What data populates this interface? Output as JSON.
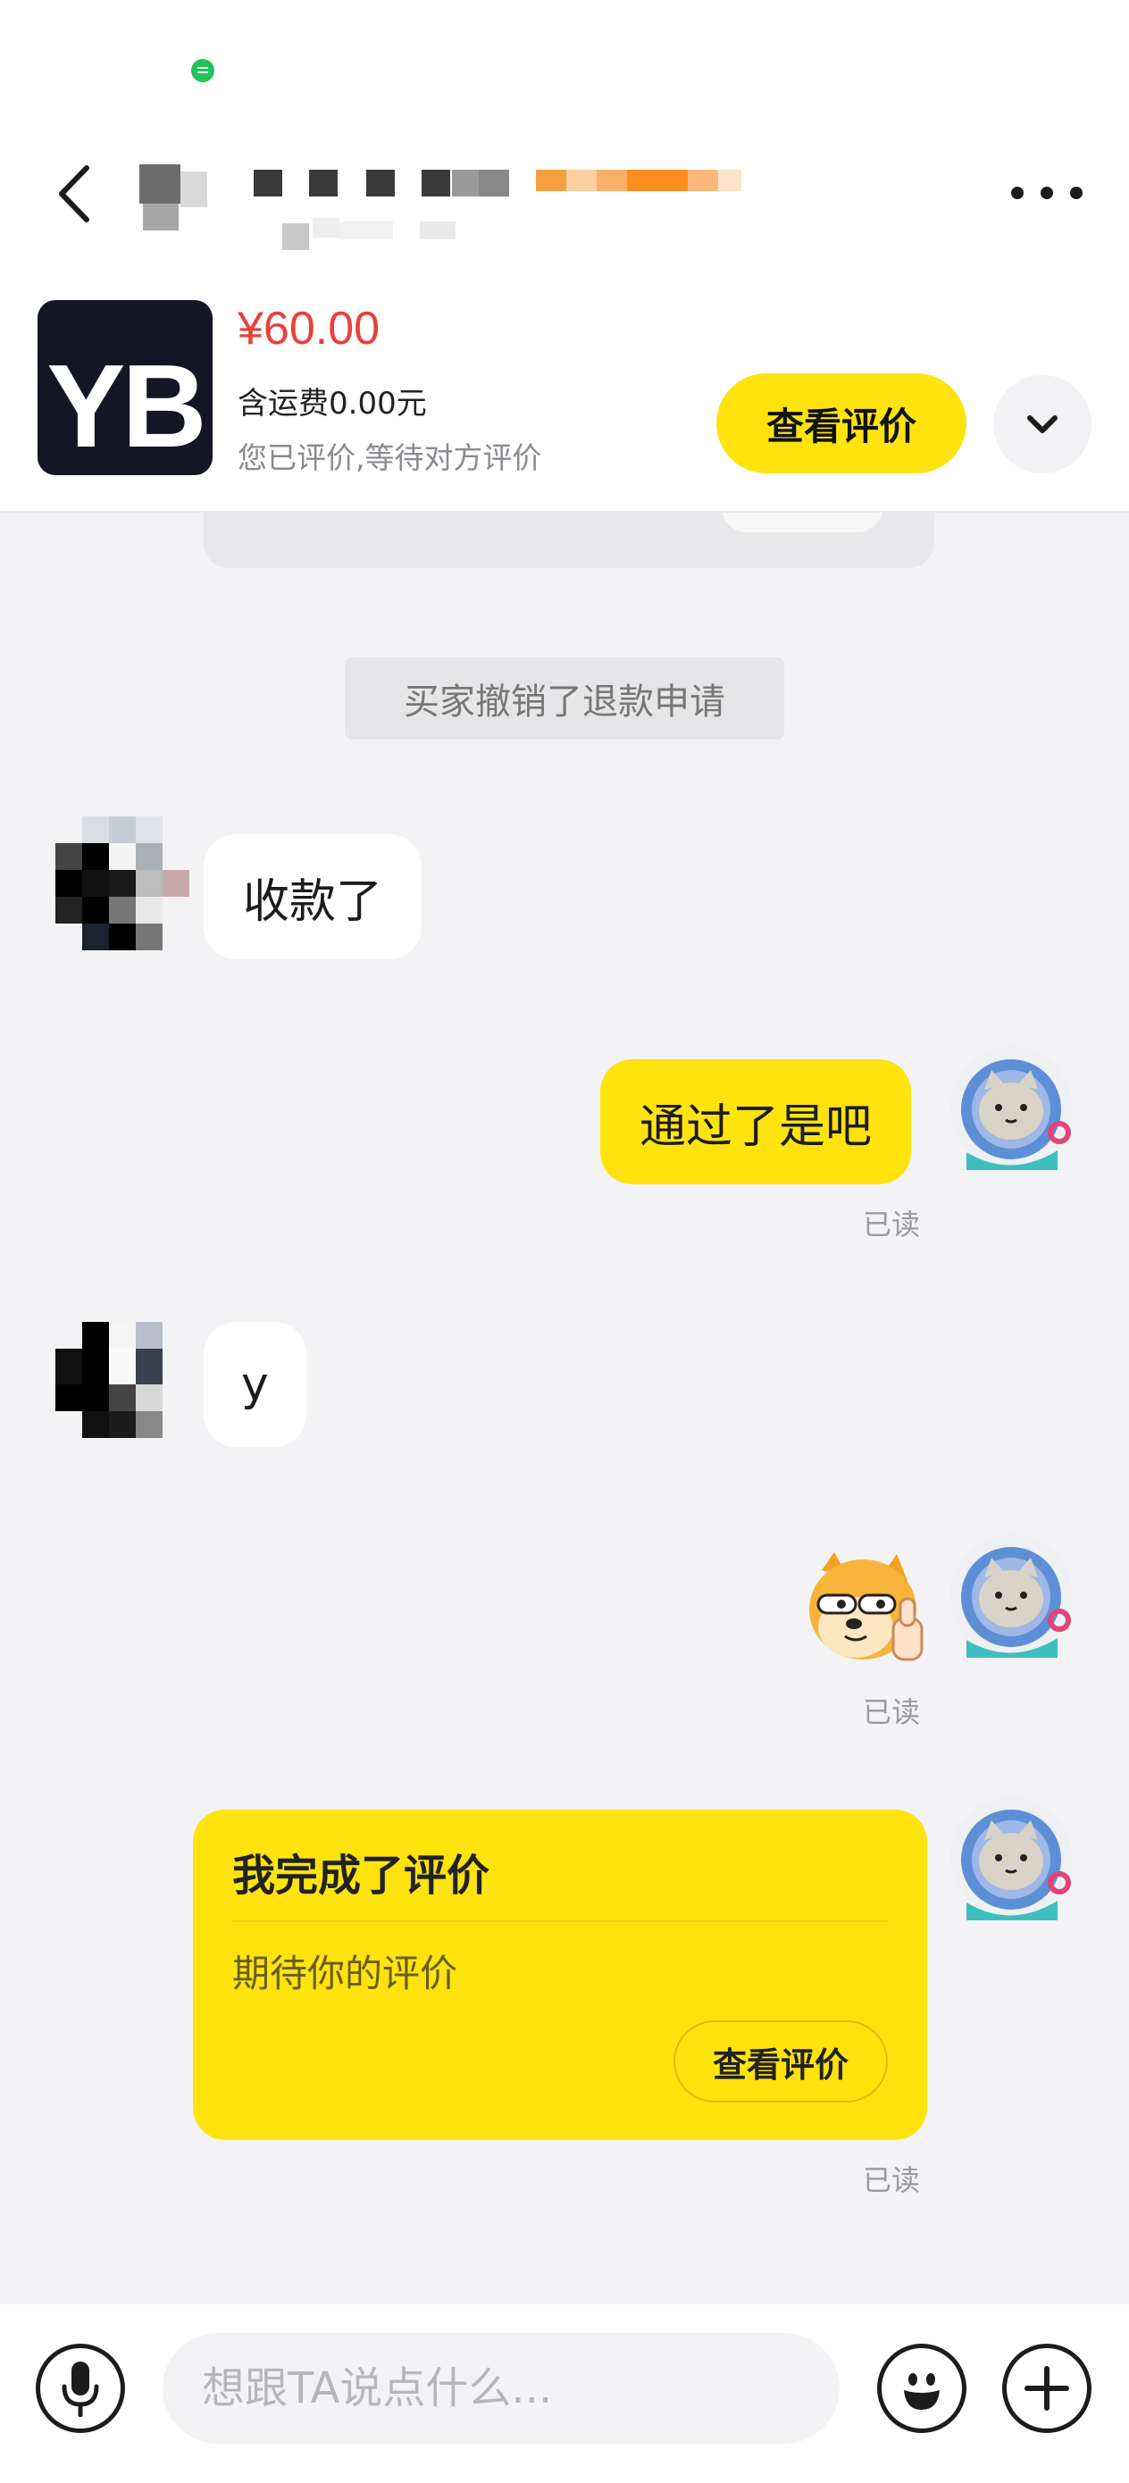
{
  "header": {
    "back_icon": "chevron-left-icon",
    "more_icon": "more-horizontal-icon"
  },
  "product": {
    "thumbnail_text": "YB",
    "price": "¥60.00",
    "shipping": "含运费0.00元",
    "review_status": "您已评价,等待对方评价",
    "view_review_label": "查看评价",
    "collapse_icon": "chevron-down-icon",
    "colors": {
      "price": "#e8403a",
      "accent": "#ffe30f"
    }
  },
  "messages": {
    "system_notice": "买家撤销了退款申请",
    "m1_text": "收款了",
    "m2_text": "通过了是吧",
    "m2_read": "已读",
    "m3_text": "y",
    "m4_sticker": "doge-thumbs-up-sticker",
    "m4_read": "已读",
    "review_card": {
      "title": "我完成了评价",
      "subtitle": "期待你的评价",
      "button": "查看评价",
      "read": "已读"
    }
  },
  "input_bar": {
    "placeholder": "想跟TA说点什么...",
    "voice_icon": "microphone-icon",
    "emoji_icon": "smiley-icon",
    "add_icon": "plus-icon"
  }
}
